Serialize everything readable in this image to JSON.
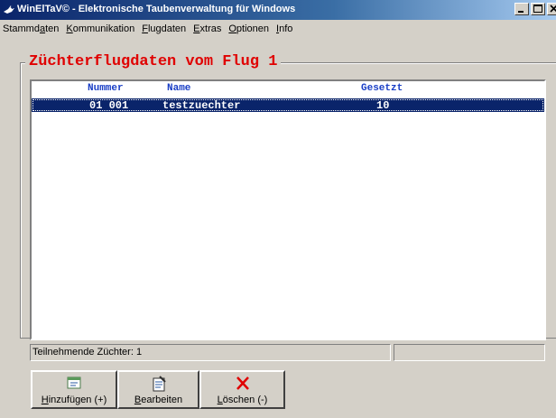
{
  "window": {
    "title": "WinElTaV© - Elektronische Taubenverwaltung für Windows"
  },
  "menu": {
    "items": [
      {
        "label": "Stammdaten"
      },
      {
        "label": "Kommunikation"
      },
      {
        "label": "Flugdaten"
      },
      {
        "label": "Extras"
      },
      {
        "label": "Optionen"
      },
      {
        "label": "Info"
      }
    ]
  },
  "group": {
    "title": "Züchterflugdaten vom Flug 1"
  },
  "list": {
    "columns": {
      "nummer": "Nummer",
      "name": "Name",
      "gesetzt": "Gesetzt"
    },
    "rows": [
      {
        "nummer": "01 001",
        "name": "testzuechter",
        "gesetzt": "10"
      }
    ]
  },
  "status": {
    "text": "Teilnehmende Züchter: 1"
  },
  "buttons": {
    "add": "Hinzufügen (+)",
    "edit": "Bearbeiten",
    "delete": "Löschen (-)"
  },
  "colors": {
    "title_text": "#e00000",
    "header_text": "#1a3fc6",
    "selection": "#0a246a"
  },
  "icons": {
    "app": "pigeon-icon",
    "add": "add-record-icon",
    "edit": "edit-record-icon",
    "delete": "red-x-icon"
  }
}
